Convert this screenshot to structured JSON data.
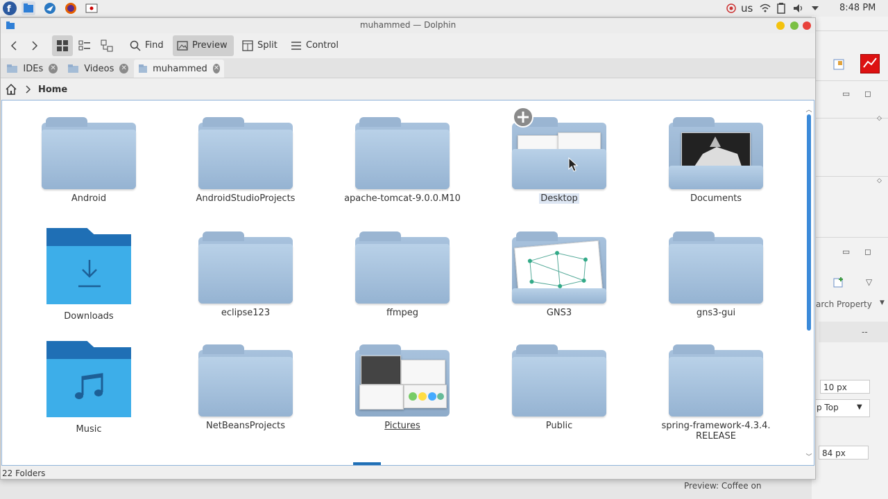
{
  "window": {
    "title": "muhammed — Dolphin",
    "accent": "#3daee9"
  },
  "system_panel": {
    "keyboard": "us",
    "time": "8:48 PM"
  },
  "toolbar": {
    "find": "Find",
    "preview": "Preview",
    "split": "Split",
    "control": "Control"
  },
  "tabs": [
    {
      "label": "IDEs"
    },
    {
      "label": "Videos"
    },
    {
      "label": "muhammed"
    }
  ],
  "breadcrumb": {
    "current": "Home"
  },
  "items": [
    {
      "label": "Android"
    },
    {
      "label": "AndroidStudioProjects"
    },
    {
      "label": "apache-tomcat-9.0.0.M10"
    },
    {
      "label": "Desktop"
    },
    {
      "label": "Documents"
    },
    {
      "label": "Downloads"
    },
    {
      "label": "eclipse123"
    },
    {
      "label": "ffmpeg"
    },
    {
      "label": "GNS3"
    },
    {
      "label": "gns3-gui"
    },
    {
      "label": "Music"
    },
    {
      "label": "NetBeansProjects"
    },
    {
      "label": "Pictures"
    },
    {
      "label": "Public"
    },
    {
      "label": "spring-framework-4.3.4.",
      "label2": "RELEASE"
    }
  ],
  "status": "22 Folders",
  "bg_window": {
    "search_property": "arch Property",
    "field1": "10 px",
    "dropdown": "p Top",
    "field2": "84 px",
    "dash": "--",
    "preview_text": "Preview: Coffee on"
  }
}
